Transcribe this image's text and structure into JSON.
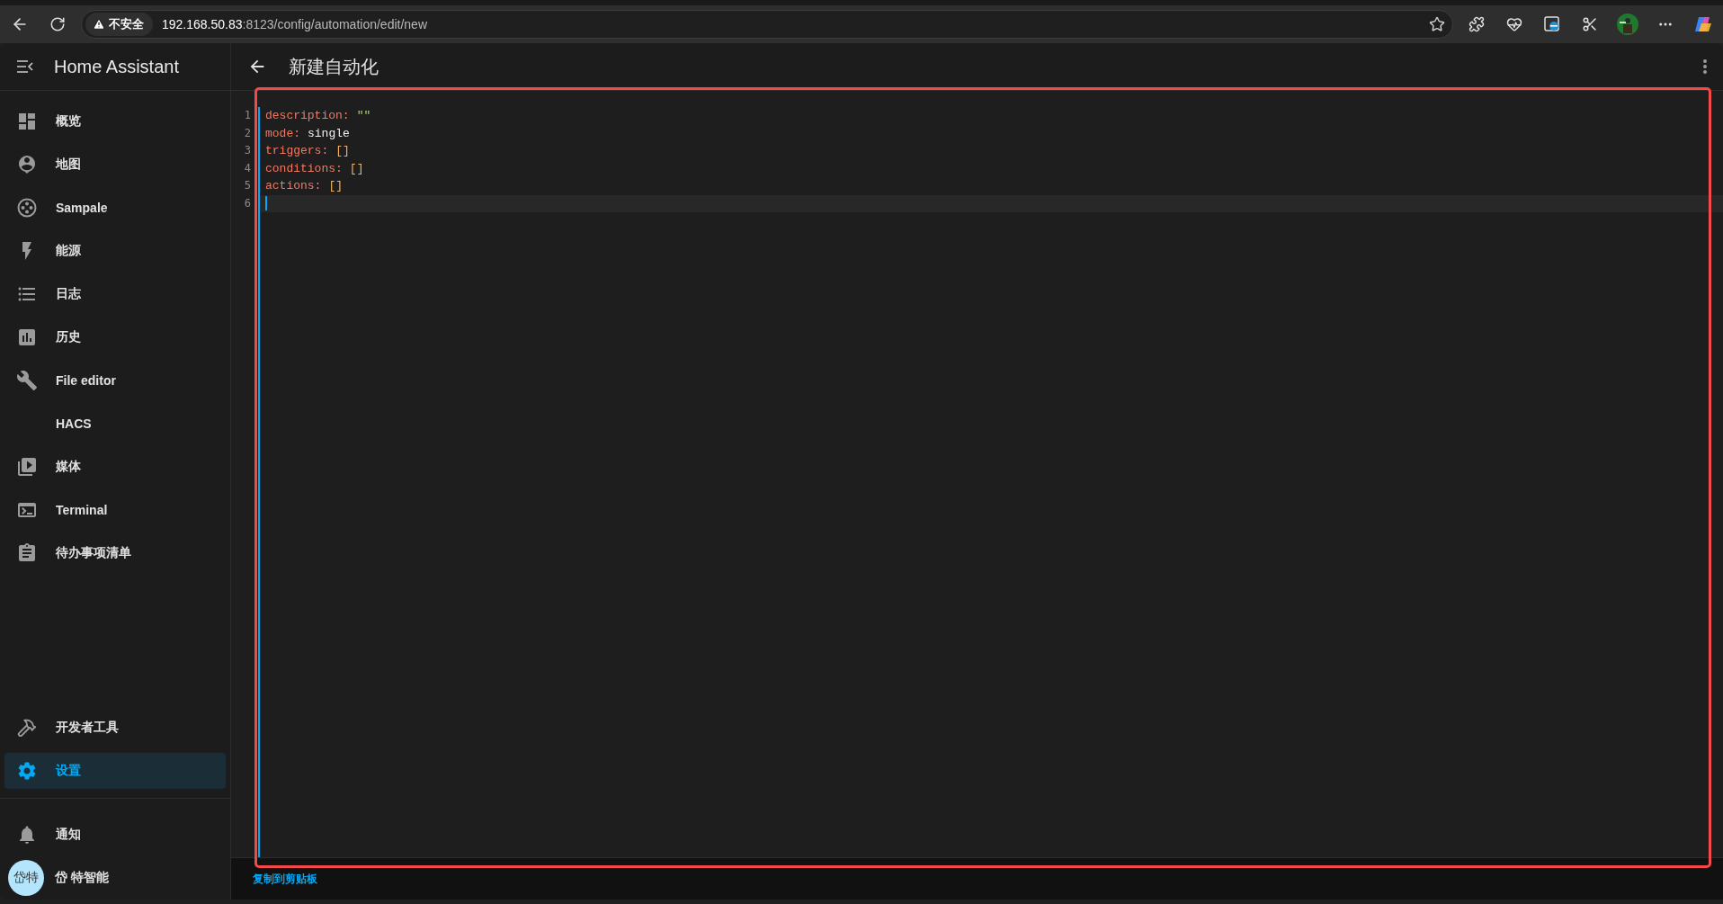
{
  "browser": {
    "security_label": "不安全",
    "url_host": "192.168.50.83",
    "url_path": ":8123/config/automation/edit/new"
  },
  "sidebar": {
    "title": "Home Assistant",
    "items": [
      {
        "label": "概览",
        "selected": false
      },
      {
        "label": "地图",
        "selected": false
      },
      {
        "label": "Sampale",
        "selected": false
      },
      {
        "label": "能源",
        "selected": false
      },
      {
        "label": "日志",
        "selected": false
      },
      {
        "label": "历史",
        "selected": false
      },
      {
        "label": "File editor",
        "selected": false
      },
      {
        "label": "HACS",
        "selected": false
      },
      {
        "label": "媒体",
        "selected": false
      },
      {
        "label": "Terminal",
        "selected": false
      },
      {
        "label": "待办事项清单",
        "selected": false
      }
    ],
    "bottom_items": [
      {
        "label": "开发者工具",
        "selected": false
      },
      {
        "label": "设置",
        "selected": true
      }
    ],
    "notifications": "通知",
    "user": {
      "avatar": "岱特",
      "name": "岱 特智能"
    }
  },
  "page": {
    "title": "新建自动化"
  },
  "editor": {
    "lines": [
      {
        "number": "1",
        "key": "description:",
        "value": "\"\"",
        "kind": "string",
        "active": false
      },
      {
        "number": "2",
        "key": "mode:",
        "value": "single",
        "kind": "plain",
        "active": false
      },
      {
        "number": "3",
        "key": "triggers:",
        "value": "[]",
        "kind": "bracket",
        "active": false
      },
      {
        "number": "4",
        "key": "conditions:",
        "value": "[]",
        "kind": "bracket",
        "active": false
      },
      {
        "number": "5",
        "key": "actions:",
        "value": "[]",
        "kind": "bracket",
        "active": false
      },
      {
        "number": "6",
        "active": true
      }
    ]
  },
  "footer": {
    "copy_link": "复制到剪贴板"
  }
}
